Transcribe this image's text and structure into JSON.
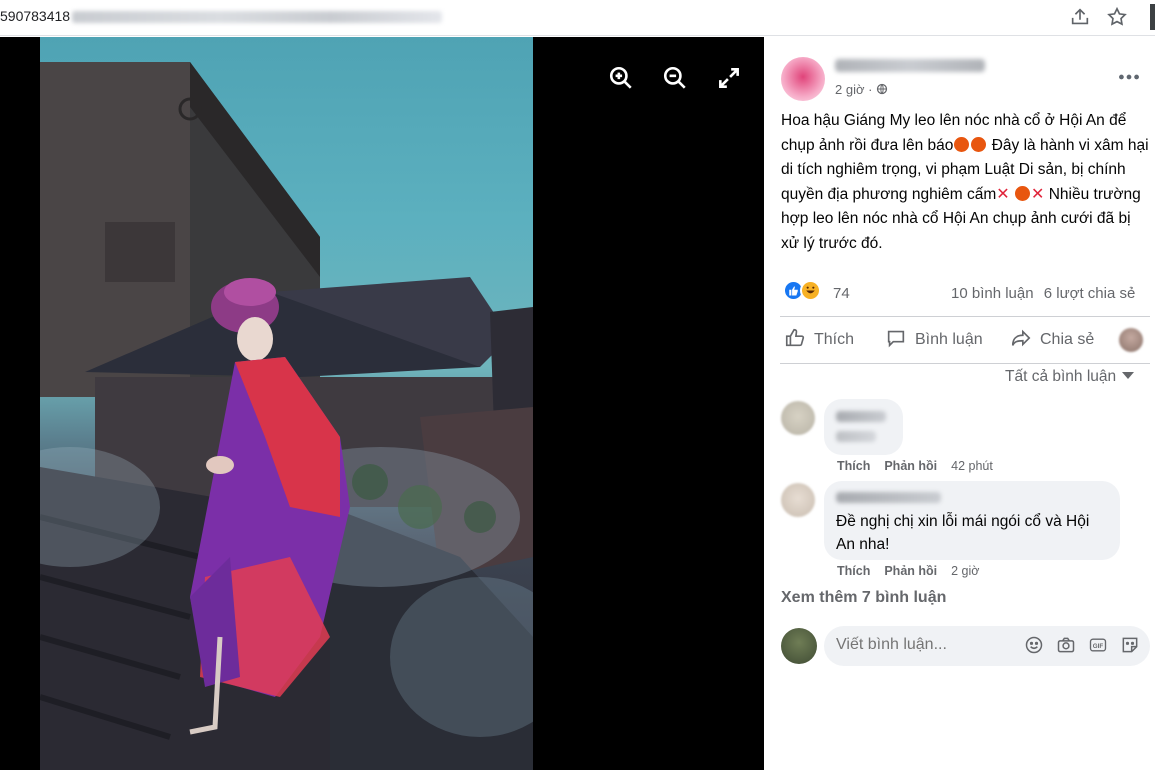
{
  "browser": {
    "url_visible": "590783418",
    "icons": [
      "share-icon",
      "star-icon"
    ]
  },
  "viewer": {
    "controls": [
      "zoom-in-icon",
      "zoom-out-icon",
      "fullscreen-icon"
    ]
  },
  "post": {
    "timestamp": "2 giờ ·",
    "text_parts": {
      "p1": "Hoa hậu Giáng My leo lên nóc nhà cổ ở Hội An để chụp ảnh rồi đưa lên báo",
      "p2": " Đây là hành vi xâm hại di tích nghiêm trọng, vi phạm Luật Di sản, bị chính quyền địa phương nghiêm cấm",
      "p3": " Nhiều trường hợp leo lên nóc nhà cổ Hội An chụp ảnh cưới đã bị xử lý trước đó."
    },
    "reaction_count": "74",
    "comments_count": "10 bình luận",
    "shares_count": "6 lượt chia sẻ",
    "actions": {
      "like": "Thích",
      "comment": "Bình luận",
      "share": "Chia sẻ"
    },
    "filter_label": "Tất cả bình luận"
  },
  "comments": [
    {
      "text": "",
      "like": "Thích",
      "reply": "Phản hồi",
      "time": "42 phút"
    },
    {
      "text": "Đề nghị chị xin lỗi mái ngói cổ và Hội An nha!",
      "like": "Thích",
      "reply": "Phản hồi",
      "time": "2 giờ"
    }
  ],
  "more_comments": "Xem thêm 7 bình luận",
  "composer": {
    "placeholder": "Viết bình luận...",
    "icons": [
      "emoji-icon",
      "camera-icon",
      "gif-icon",
      "sticker-icon"
    ]
  },
  "colors": {
    "accent": "#1877f2",
    "secondary_text": "#65676b",
    "bubble_bg": "#f0f2f5",
    "reaction_haha": "#f7b125",
    "cross_red": "#e0243a"
  }
}
